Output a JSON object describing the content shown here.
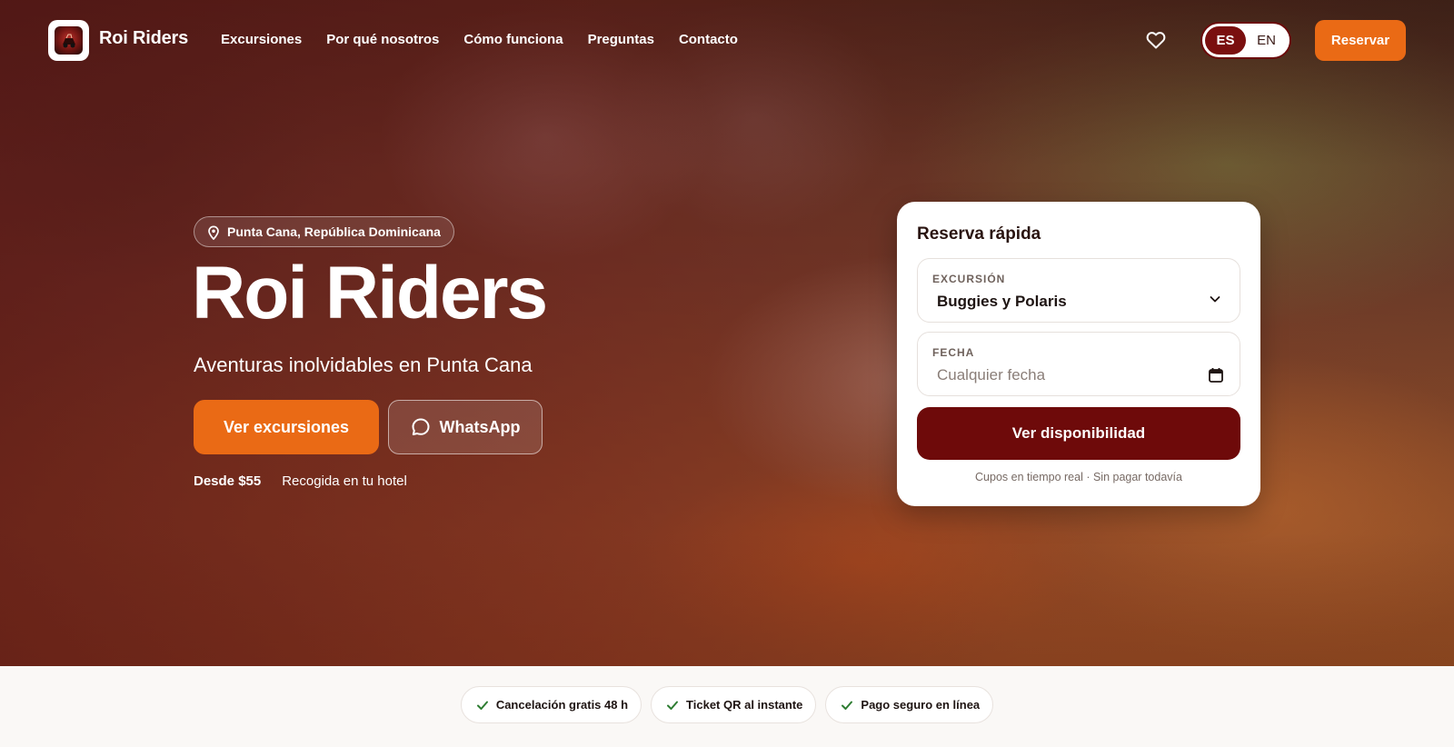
{
  "brand": {
    "name": "Roi Riders"
  },
  "nav": {
    "links": [
      "Excursiones",
      "Por qué nosotros",
      "Cómo funciona",
      "Preguntas",
      "Contacto"
    ],
    "lang_es": "ES",
    "lang_en": "EN",
    "active_lang": "ES",
    "reserve": "Reservar"
  },
  "hero": {
    "location": "Punta Cana, República Dominicana",
    "title": "Roi Riders",
    "subtitle": "Aventuras inolvidables en Punta Cana",
    "cta_primary": "Ver excursiones",
    "cta_secondary": "WhatsApp",
    "price": "Desde $55",
    "pickup": "Recogida en tu hotel"
  },
  "booking": {
    "title": "Reserva rápida",
    "excursion_label": "EXCURSIÓN",
    "excursion_value": "Buggies y Polaris",
    "date_label": "FECHA",
    "date_placeholder": "Cualquier fecha",
    "button": "Ver disponibilidad",
    "note": "Cupos en tiempo real · Sin pagar todavía"
  },
  "badges": [
    "Cancelación gratis 48 h",
    "Ticket QR al instante",
    "Pago seguro en línea"
  ],
  "colors": {
    "accent": "#ea6a15",
    "brand_dark": "#6e0a0a",
    "check": "#2e7d32"
  },
  "icons": {
    "location": "map-pin-icon",
    "whatsapp": "chat-bubble-icon",
    "favorites": "heart-icon",
    "select": "chevron-down-icon",
    "date": "calendar-icon",
    "badge": "check-icon"
  }
}
